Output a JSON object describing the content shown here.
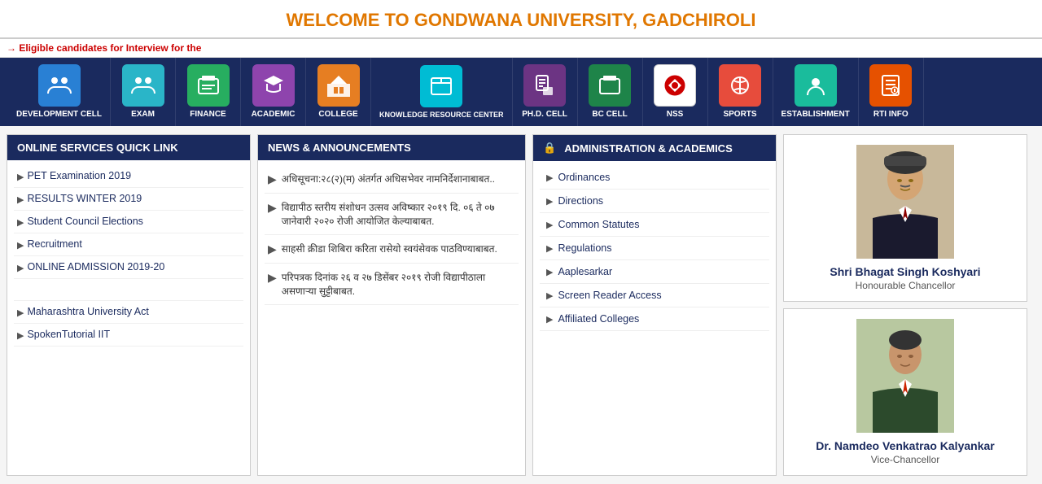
{
  "header": {
    "title_plain": "WELCOME TO ",
    "title_highlighted": "GONDWANA UNIVERSITY, GADCHIROLI"
  },
  "ticker": {
    "arrow": "→",
    "text": "Eligible candidates for Interview for the"
  },
  "nav": {
    "items": [
      {
        "id": "development-cell",
        "label": "DEVELOPMENT CELL",
        "icon_color": "icon-blue",
        "icon": "people"
      },
      {
        "id": "exam",
        "label": "EXAM",
        "icon_color": "icon-teal",
        "icon": "people"
      },
      {
        "id": "finance",
        "label": "FINANCE",
        "icon_color": "icon-green",
        "icon": "finance"
      },
      {
        "id": "academic",
        "label": "ACADEMIC",
        "icon_color": "icon-purple",
        "icon": "academic"
      },
      {
        "id": "college",
        "label": "COLLEGE",
        "icon_color": "icon-orange",
        "icon": "college"
      },
      {
        "id": "knowledge-resource",
        "label": "Knowledge Resource Center",
        "icon_color": "icon-cyan",
        "icon": "knowledge"
      },
      {
        "id": "phd-cell",
        "label": "Ph.D. Cell",
        "icon_color": "icon-violet",
        "icon": "phd"
      },
      {
        "id": "bc-cell",
        "label": "BC CELL",
        "icon_color": "icon-darkgreen",
        "icon": "bc"
      },
      {
        "id": "nss",
        "label": "NSS",
        "icon_color": "icon-white",
        "icon": "nss"
      },
      {
        "id": "sports",
        "label": "SPORTS",
        "icon_color": "icon-red",
        "icon": "sports"
      },
      {
        "id": "establishment",
        "label": "ESTABLISHMENT",
        "icon_color": "icon-darkteal",
        "icon": "establishment"
      },
      {
        "id": "rti-info",
        "label": "RTI INFO",
        "icon_color": "icon-orange2",
        "icon": "rti"
      }
    ]
  },
  "quick_links": {
    "header": "ONLINE SERVICES QUICK LINK",
    "items": [
      {
        "text": "PET Examination 2019"
      },
      {
        "text": "RESULTS WINTER 2019"
      },
      {
        "text": "Student Council Elections"
      },
      {
        "text": "Recruitment"
      },
      {
        "text": "ONLINE ADMISSION 2019-20"
      },
      {
        "text": ""
      },
      {
        "text": "Maharashtra University Act"
      },
      {
        "text": "SpokenTutorial IIT"
      }
    ]
  },
  "news": {
    "header": "NEWS & ANNOUNCEMENTS",
    "items": [
      {
        "text": "अधिसूचना:२८(२)(म) अंतर्गत अधिसभेवर नामनिर्देशानाबाबत.."
      },
      {
        "text": "विद्यापीठ स्तरीय संशोधन उत्सव अविष्कार २०१९ दि. ०६ ते ०७ जानेवारी २०२० रोजी आयोजित केल्याबाबत."
      },
      {
        "text": "साहसी क्रीडा शिबिरा करिता रासेयो स्वयंसेवक पाठविण्याबाबत."
      },
      {
        "text": "परिपत्रक दिनांक २६ व २७ डिसेंबर २०१९ रोजी विद्यापीठाला असणाऱ्या सुट्टीबाबत."
      }
    ]
  },
  "admin": {
    "header": "ADMINISTRATION & ACADEMICS",
    "items": [
      {
        "text": "Ordinances"
      },
      {
        "text": "Directions"
      },
      {
        "text": "Common Statutes"
      },
      {
        "text": "Regulations"
      },
      {
        "text": "Aaplesarkar"
      },
      {
        "text": "Screen Reader Access"
      },
      {
        "text": "Affiliated Colleges"
      }
    ]
  },
  "officials": [
    {
      "name": "Shri Bhagat Singh Koshyari",
      "title": "Honourable Chancellor"
    },
    {
      "name": "Dr. Namdeo Venkatrao Kalyankar",
      "title": "Vice-Chancellor"
    }
  ]
}
